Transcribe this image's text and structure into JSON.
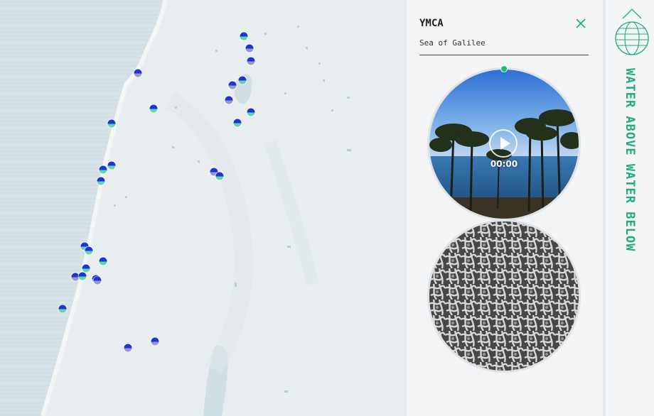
{
  "panel": {
    "title": "YMCA",
    "subtitle": "Sea of Galilee",
    "timecode": "00:00"
  },
  "sidebar": {
    "title": "WATER ABOVE WATER BELOW"
  },
  "colors": {
    "brand": "#1fae74",
    "marker_top": "#1f34d6",
    "marker_green": "#5fd6a4",
    "marker_purple": "#9a98c8",
    "sea": "#d4e1e6"
  },
  "map": {
    "markers": [
      {
        "type": "green"
      },
      {
        "type": "purple"
      },
      {
        "type": "purple"
      },
      {
        "type": "purple"
      },
      {
        "type": "green"
      },
      {
        "type": "purple"
      },
      {
        "type": "purple"
      },
      {
        "type": "green"
      },
      {
        "type": "green"
      },
      {
        "type": "green"
      },
      {
        "type": "green"
      },
      {
        "type": "green"
      },
      {
        "type": "green"
      },
      {
        "type": "green"
      },
      {
        "type": "purple"
      },
      {
        "type": "green"
      },
      {
        "type": "green"
      },
      {
        "type": "green"
      },
      {
        "type": "green"
      },
      {
        "type": "green"
      },
      {
        "type": "purple"
      },
      {
        "type": "green"
      },
      {
        "type": "purple"
      },
      {
        "type": "purple"
      },
      {
        "type": "green"
      },
      {
        "type": "purple"
      },
      {
        "type": "purple"
      }
    ]
  }
}
